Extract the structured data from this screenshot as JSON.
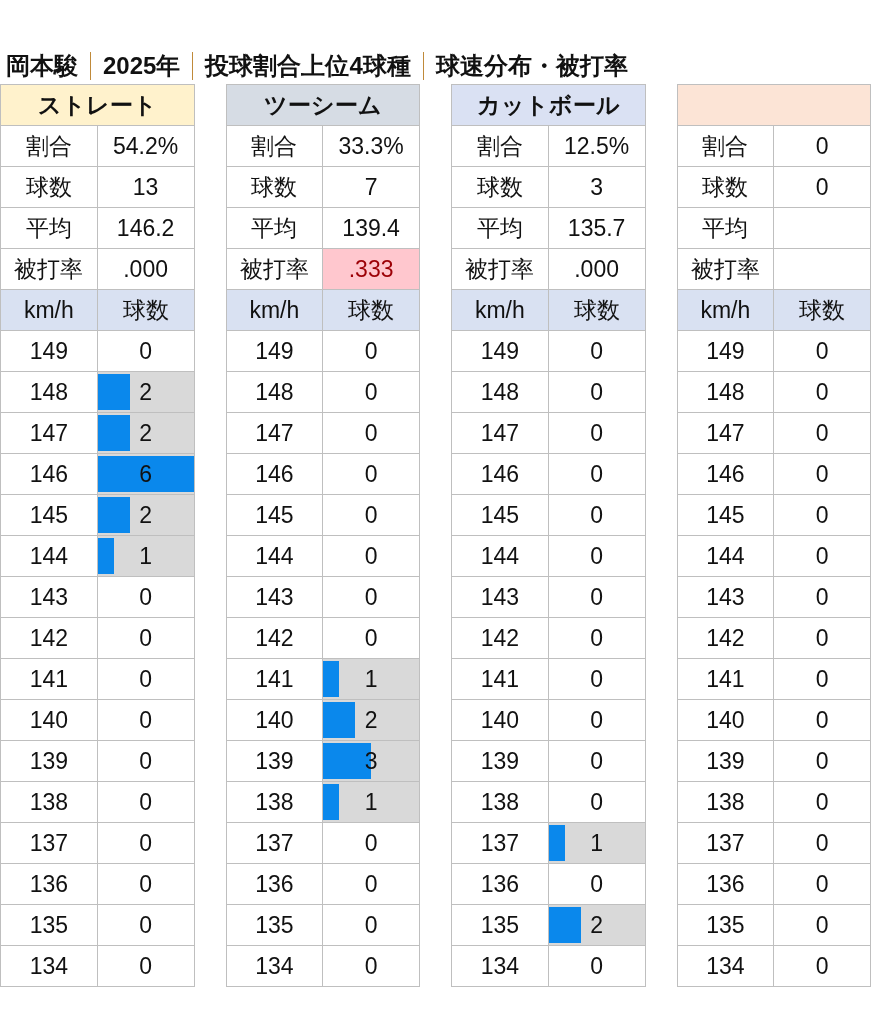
{
  "title_parts": [
    "岡本駿",
    "2025年",
    "投球割合上位4球種",
    "球速分布・被打率"
  ],
  "panels": [
    {
      "name": "ストレート",
      "color": "#fff2cc",
      "stats": [
        {
          "label": "割合",
          "value": "54.2%",
          "highlight": false
        },
        {
          "label": "球数",
          "value": "13",
          "highlight": false
        },
        {
          "label": "平均",
          "value": "146.2",
          "highlight": false
        },
        {
          "label": "被打率",
          "value": ".000",
          "highlight": false
        }
      ],
      "columns": [
        "km/h",
        "球数"
      ],
      "rows": [
        {
          "speed": "149",
          "count": "0"
        },
        {
          "speed": "148",
          "count": "2",
          "level": 0.333
        },
        {
          "speed": "147",
          "count": "2",
          "level": 0.333
        },
        {
          "speed": "146",
          "count": "6",
          "level": 1
        },
        {
          "speed": "145",
          "count": "2",
          "level": 0.333
        },
        {
          "speed": "144",
          "count": "1",
          "level": 0.167
        },
        {
          "speed": "143",
          "count": "0"
        },
        {
          "speed": "142",
          "count": "0"
        },
        {
          "speed": "141",
          "count": "0"
        },
        {
          "speed": "140",
          "count": "0"
        },
        {
          "speed": "139",
          "count": "0"
        },
        {
          "speed": "138",
          "count": "0"
        },
        {
          "speed": "137",
          "count": "0"
        },
        {
          "speed": "136",
          "count": "0"
        },
        {
          "speed": "135",
          "count": "0"
        },
        {
          "speed": "134",
          "count": "0"
        }
      ]
    },
    {
      "name": "ツーシーム",
      "color": "#d6dce4",
      "stats": [
        {
          "label": "割合",
          "value": "33.3%",
          "highlight": false
        },
        {
          "label": "球数",
          "value": "7",
          "highlight": false
        },
        {
          "label": "平均",
          "value": "139.4",
          "highlight": false
        },
        {
          "label": "被打率",
          "value": ".333",
          "highlight": true
        }
      ],
      "columns": [
        "km/h",
        "球数"
      ],
      "rows": [
        {
          "speed": "149",
          "count": "0"
        },
        {
          "speed": "148",
          "count": "0"
        },
        {
          "speed": "147",
          "count": "0"
        },
        {
          "speed": "146",
          "count": "0"
        },
        {
          "speed": "145",
          "count": "0"
        },
        {
          "speed": "144",
          "count": "0"
        },
        {
          "speed": "143",
          "count": "0"
        },
        {
          "speed": "142",
          "count": "0"
        },
        {
          "speed": "141",
          "count": "1",
          "level": 0.167
        },
        {
          "speed": "140",
          "count": "2",
          "level": 0.333
        },
        {
          "speed": "139",
          "count": "3",
          "level": 0.5
        },
        {
          "speed": "138",
          "count": "1",
          "level": 0.167
        },
        {
          "speed": "137",
          "count": "0"
        },
        {
          "speed": "136",
          "count": "0"
        },
        {
          "speed": "135",
          "count": "0"
        },
        {
          "speed": "134",
          "count": "0"
        }
      ]
    },
    {
      "name": "カットボール",
      "color": "#dae1f3",
      "stats": [
        {
          "label": "割合",
          "value": "12.5%",
          "highlight": false
        },
        {
          "label": "球数",
          "value": "3",
          "highlight": false
        },
        {
          "label": "平均",
          "value": "135.7",
          "highlight": false
        },
        {
          "label": "被打率",
          "value": ".000",
          "highlight": false
        }
      ],
      "columns": [
        "km/h",
        "球数"
      ],
      "rows": [
        {
          "speed": "149",
          "count": "0"
        },
        {
          "speed": "148",
          "count": "0"
        },
        {
          "speed": "147",
          "count": "0"
        },
        {
          "speed": "146",
          "count": "0"
        },
        {
          "speed": "145",
          "count": "0"
        },
        {
          "speed": "144",
          "count": "0"
        },
        {
          "speed": "143",
          "count": "0"
        },
        {
          "speed": "142",
          "count": "0"
        },
        {
          "speed": "141",
          "count": "0"
        },
        {
          "speed": "140",
          "count": "0"
        },
        {
          "speed": "139",
          "count": "0"
        },
        {
          "speed": "138",
          "count": "0"
        },
        {
          "speed": "137",
          "count": "1",
          "level": 0.167
        },
        {
          "speed": "136",
          "count": "0"
        },
        {
          "speed": "135",
          "count": "2",
          "level": 0.333
        },
        {
          "speed": "134",
          "count": "0"
        }
      ]
    },
    {
      "color": "#fce4d6",
      "stats": [
        {
          "label": "割合",
          "value": "0",
          "highlight": false
        },
        {
          "label": "球数",
          "value": "0",
          "highlight": false
        },
        {
          "label": "平均",
          "highlight": false
        },
        {
          "label": "被打率",
          "highlight": false
        }
      ],
      "columns": [
        "km/h",
        "球数"
      ],
      "rows": [
        {
          "speed": "149",
          "count": "0"
        },
        {
          "speed": "148",
          "count": "0"
        },
        {
          "speed": "147",
          "count": "0"
        },
        {
          "speed": "146",
          "count": "0"
        },
        {
          "speed": "145",
          "count": "0"
        },
        {
          "speed": "144",
          "count": "0"
        },
        {
          "speed": "143",
          "count": "0"
        },
        {
          "speed": "142",
          "count": "0"
        },
        {
          "speed": "141",
          "count": "0"
        },
        {
          "speed": "140",
          "count": "0"
        },
        {
          "speed": "139",
          "count": "0"
        },
        {
          "speed": "138",
          "count": "0"
        },
        {
          "speed": "137",
          "count": "0"
        },
        {
          "speed": "136",
          "count": "0"
        },
        {
          "speed": "135",
          "count": "0"
        },
        {
          "speed": "134",
          "count": "0"
        }
      ]
    }
  ]
}
